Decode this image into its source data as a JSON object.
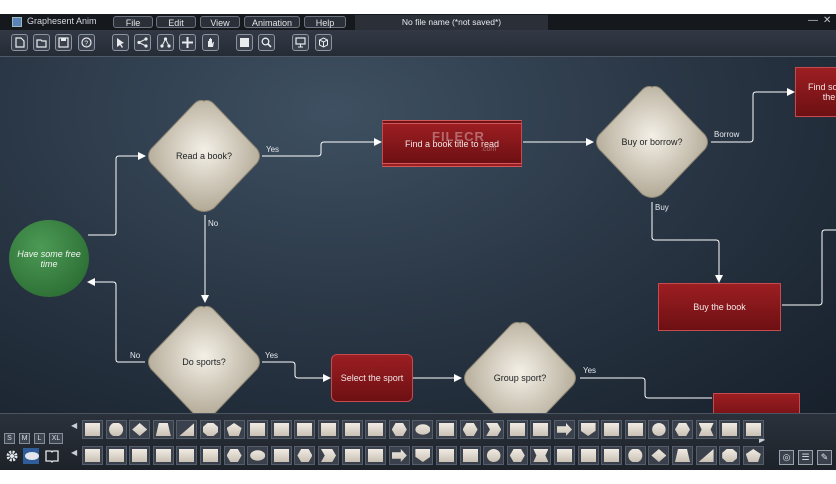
{
  "window": {
    "app_title": "Graphesent Anim",
    "file_tab": "No file name (*not saved*)",
    "minimize": "—",
    "close": "✕"
  },
  "menu": [
    "File",
    "Edit",
    "View",
    "Animation",
    "Help"
  ],
  "toolbar": {
    "buttons": [
      "new-file-icon",
      "open-folder-icon",
      "save-icon",
      "help-icon",
      "pointer-icon",
      "share-icon",
      "hierarchy-icon",
      "move-icon",
      "hand-icon",
      "frame-icon",
      "zoom-icon",
      "screen-icon",
      "cube-icon"
    ]
  },
  "flowchart": {
    "nodes": {
      "start": "Have some free time",
      "read_book": "Read a book?",
      "do_sports": "Do sports?",
      "find_book": "Find a book title to read",
      "buy_borrow": "Buy or borrow?",
      "buy_book": "Buy the book",
      "find_some": "Find some the",
      "select_sport": "Select the sport",
      "group_sport": "Group sport?"
    },
    "edge_labels": {
      "yes1": "Yes",
      "no1": "No",
      "no2": "No",
      "yes2": "Yes",
      "borrow": "Borrow",
      "buy": "Buy",
      "yes3": "Yes"
    },
    "watermark": "FILECR",
    "watermark_sub": ".com"
  },
  "palette": {
    "sizes": [
      "S",
      "M",
      "L",
      "XL"
    ],
    "left_icons": [
      "gear-icon",
      "ellipse-icon",
      "book-icon"
    ],
    "right_icons": [
      "palette-icon",
      "list-icon",
      "brush-icon"
    ]
  },
  "colors": {
    "decision_fill": "#ddd6c7",
    "process_fill": "#8c1a1e",
    "start_fill": "#2f7a3a",
    "edge_color": "#ffffff"
  }
}
